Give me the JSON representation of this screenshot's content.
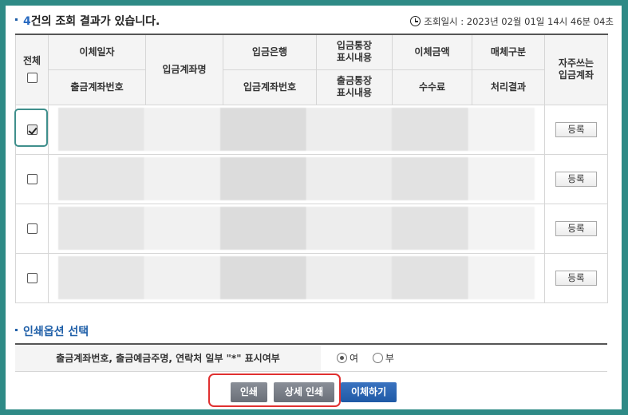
{
  "result": {
    "count": "4",
    "title_rest": "건의 조회 결과가 있습니다.",
    "inquiry_label": "조회일시 : ",
    "inquiry_value": "2023년 02월 01일 14시 46분 04초"
  },
  "table": {
    "select_all": "전체",
    "transfer_date": "이체일자",
    "withdraw_account": "출금계좌번호",
    "deposit_name": "입금계좌명",
    "deposit_bank": "입금은행",
    "deposit_account": "입금계좌번호",
    "deposit_memo": "입금통장\n표시내용",
    "withdraw_memo": "출금통장\n표시내용",
    "amount": "이체금액",
    "fee": "수수료",
    "media_type": "매체구분",
    "result": "처리결과",
    "favorite": "자주쓰는\n입금계좌"
  },
  "rows": [
    {
      "checked": true,
      "register_label": "등록"
    },
    {
      "checked": false,
      "register_label": "등록"
    },
    {
      "checked": false,
      "register_label": "등록"
    },
    {
      "checked": false,
      "register_label": "등록"
    }
  ],
  "print_options": {
    "title": "인쇄옵션 선택",
    "mask_label": "출금계좌번호, 출금예금주명, 연락처 일부 \"*\" 표시여부",
    "yes": "여",
    "no": "부",
    "selected": "여"
  },
  "buttons": {
    "print": "인쇄",
    "detail_print": "상세 인쇄",
    "transfer": "이체하기"
  },
  "colors": {
    "frame": "#2e8a86",
    "accent_blue": "#2a6bc1",
    "highlight_red": "#e03030"
  }
}
